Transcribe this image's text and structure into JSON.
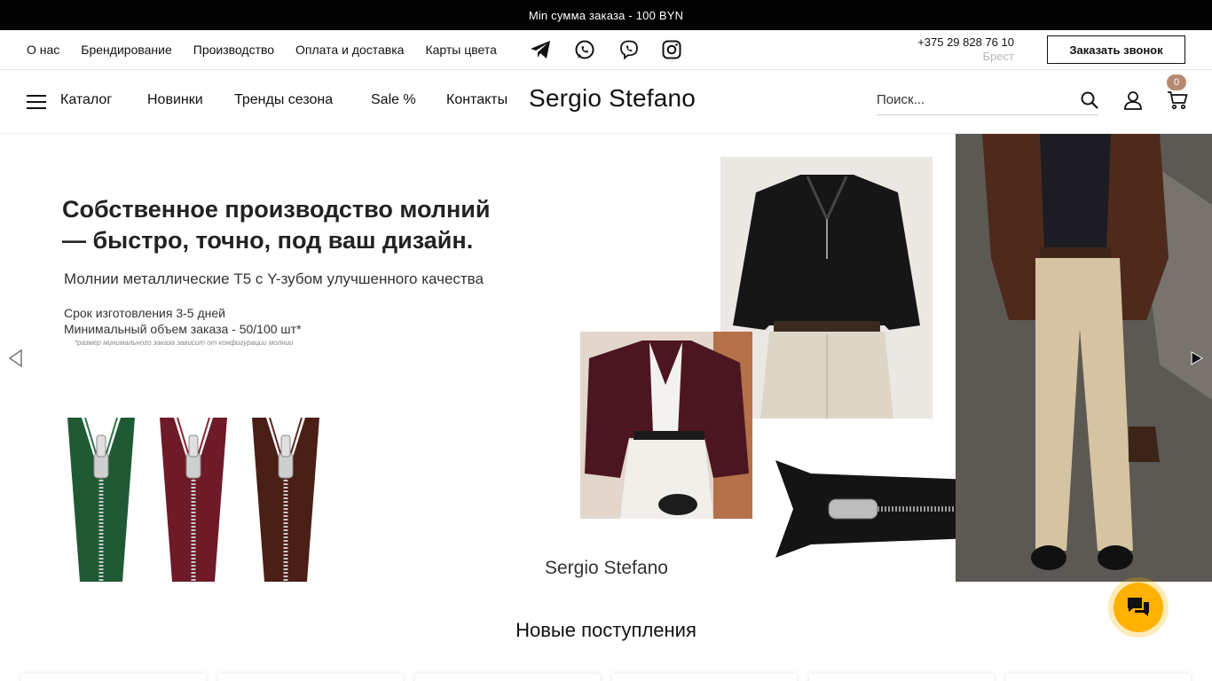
{
  "announcement": "Min сумма заказа - 100 BYN",
  "info_links": [
    "О нас",
    "Брендирование",
    "Производство",
    "Оплата и доставка",
    "Карты цвета"
  ],
  "social_icons": [
    "telegram-icon",
    "whatsapp-icon",
    "viber-icon",
    "instagram-icon"
  ],
  "contact": {
    "phone": "+375 29 828 76 10",
    "city": "Брест"
  },
  "callback_label": "Заказать звонок",
  "nav": {
    "catalog": "Каталог",
    "items": [
      "Новинки",
      "Тренды сезона",
      "Sale %",
      "Контакты"
    ],
    "logo": "Sergio Stefano",
    "search_placeholder": "Поиск...",
    "cart_count": "0"
  },
  "banner": {
    "headline": "Собственное производство молний\n— быстро, точно, под ваш дизайн.",
    "subheadline": "Молнии металлические Т5 с Y-зубом улучшенного качества",
    "terms": "Срок изготовления 3-5 дней\nМинимальный объем заказа  - 50/100 шт*",
    "footnote": "*размер минимального заказа зависит от конфигурации молнии",
    "logo": "Sergio Stefano",
    "zipper_colors": [
      "#1f5a35",
      "#6e1a28",
      "#4a1f16"
    ]
  },
  "section_title": "Новые поступления",
  "colors": {
    "accent": "#ffb000",
    "cart_badge": "#b68a72",
    "topbar": "#000000"
  }
}
